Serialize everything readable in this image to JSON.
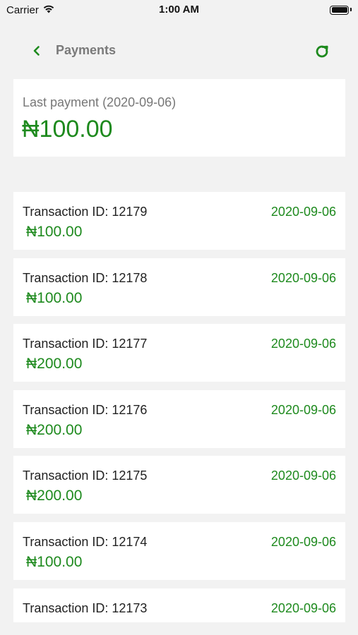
{
  "status_bar": {
    "carrier": "Carrier",
    "time": "1:00 AM"
  },
  "nav": {
    "title": "Payments"
  },
  "last_payment": {
    "label": "Last payment (2020-09-06)",
    "amount": "₦100.00"
  },
  "transactions": [
    {
      "id_text": "Transaction ID: 12179",
      "date": "2020-09-06",
      "amount": "₦100.00"
    },
    {
      "id_text": "Transaction ID: 12178",
      "date": "2020-09-06",
      "amount": "₦100.00"
    },
    {
      "id_text": "Transaction ID: 12177",
      "date": "2020-09-06",
      "amount": "₦200.00"
    },
    {
      "id_text": "Transaction ID: 12176",
      "date": "2020-09-06",
      "amount": "₦200.00"
    },
    {
      "id_text": "Transaction ID: 12175",
      "date": "2020-09-06",
      "amount": "₦200.00"
    },
    {
      "id_text": "Transaction ID: 12174",
      "date": "2020-09-06",
      "amount": "₦100.00"
    },
    {
      "id_text": "Transaction ID: 12173",
      "date": "2020-09-06",
      "amount": ""
    }
  ],
  "colors": {
    "accent": "#1e8a1e",
    "background": "#f2f2f2",
    "card": "#ffffff"
  },
  "icons": {
    "back": "chevron-left-icon",
    "refresh": "refresh-icon",
    "wifi": "wifi-icon",
    "battery": "battery-icon"
  }
}
